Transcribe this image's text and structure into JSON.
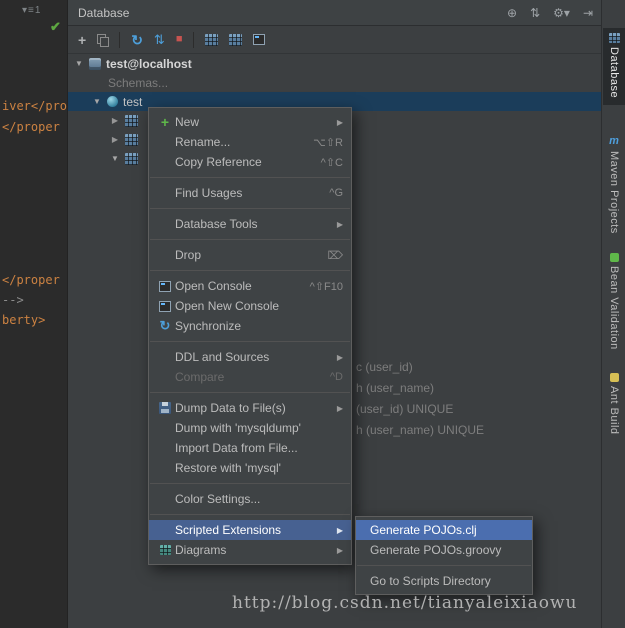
{
  "watermark": "http://blog.csdn.net/tianyaleixiaowu",
  "colors": {
    "panel_bg": "#3c3f41",
    "editor_bg": "#2b2b2b",
    "selection_blue": "#4b6eaf",
    "tree_selection": "#1b3d5a",
    "accent_green": "#5fb84a",
    "accent_red": "#c75450",
    "accent_blue": "#4d9fda"
  },
  "glyphs": {
    "expanded": "▼",
    "collapsed": "▶",
    "submenu_arrow": "▶",
    "plus": "+",
    "sync": "↻",
    "swap": "⇅",
    "stop": "■",
    "check": "✔",
    "gutter": "▾≡1"
  },
  "editor": {
    "code_lines": [
      {
        "text": "iver</pro"
      },
      {
        "text": "</proper"
      },
      {
        "text": "</proper"
      },
      {
        "text": "-->"
      },
      {
        "text": "berty>"
      }
    ]
  },
  "panel": {
    "title": "Database",
    "header_icons": [
      {
        "name": "settings-circle",
        "glyph": "⊕"
      },
      {
        "name": "scroll-from-source",
        "glyph": "⇅"
      },
      {
        "name": "gear-menu",
        "glyph": "⚙▾"
      },
      {
        "name": "hide-panel",
        "glyph": "⇥"
      }
    ]
  },
  "tree": {
    "nodes": [
      {
        "label": "test@localhost"
      },
      {
        "label": "Schemas..."
      },
      {
        "label": "test"
      }
    ],
    "fragments": [
      "c (user_id)",
      "h (user_name)",
      "(user_id) UNIQUE",
      "h (user_name) UNIQUE"
    ]
  },
  "menu": {
    "items": [
      {
        "label": "New",
        "submenu": true,
        "icon": "plus"
      },
      {
        "label": "Rename...",
        "shortcut": "⌥⇧R"
      },
      {
        "label": "Copy Reference",
        "shortcut": "^⇧C"
      },
      {
        "label": "Find Usages",
        "shortcut": "^G"
      },
      {
        "label": "Database Tools",
        "submenu": true
      },
      {
        "label": "Drop",
        "shortcut": "⌦"
      },
      {
        "label": "Open Console",
        "shortcut": "^⇧F10",
        "icon": "console"
      },
      {
        "label": "Open New Console",
        "icon": "console"
      },
      {
        "label": "Synchronize",
        "icon": "sync"
      },
      {
        "label": "DDL and Sources",
        "submenu": true
      },
      {
        "label": "Compare",
        "shortcut": "^D",
        "disabled": true
      },
      {
        "label": "Dump Data to File(s)",
        "submenu": true,
        "icon": "save"
      },
      {
        "label": "Dump with 'mysqldump'"
      },
      {
        "label": "Import Data from File..."
      },
      {
        "label": "Restore with 'mysql'"
      },
      {
        "label": "Color Settings..."
      },
      {
        "label": "Scripted Extensions",
        "submenu": true,
        "highlighted": true
      },
      {
        "label": "Diagrams",
        "submenu": true,
        "icon": "diagram"
      }
    ]
  },
  "submenu": {
    "items": [
      {
        "label": "Generate POJOs.clj",
        "selected": true
      },
      {
        "label": "Generate POJOs.groovy"
      },
      {
        "label": "Go to Scripts Directory"
      }
    ]
  },
  "sidebar": {
    "tabs": [
      {
        "label": "Database",
        "active": true
      },
      {
        "label": "Maven Projects",
        "icon_letter": "m"
      },
      {
        "label": "Bean Validation"
      },
      {
        "label": "Ant Build"
      }
    ]
  }
}
